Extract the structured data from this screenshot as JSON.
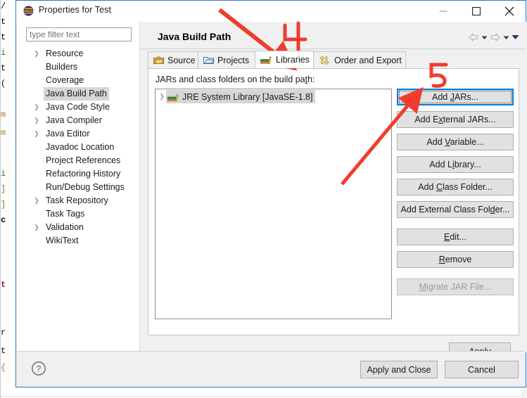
{
  "window": {
    "title": "Properties for Test",
    "app_icon": "eclipse-logo-icon",
    "controls": {
      "minimize": "minimize-icon",
      "maximize": "maximize-icon",
      "close": "close-icon"
    }
  },
  "sidebar": {
    "filter": {
      "placeholder": "type filter text",
      "value": ""
    },
    "items": [
      {
        "label": "Resource",
        "expandable": true,
        "selected": false
      },
      {
        "label": "Builders",
        "expandable": false,
        "selected": false
      },
      {
        "label": "Coverage",
        "expandable": false,
        "selected": false
      },
      {
        "label": "Java Build Path",
        "expandable": false,
        "selected": true
      },
      {
        "label": "Java Code Style",
        "expandable": true,
        "selected": false
      },
      {
        "label": "Java Compiler",
        "expandable": true,
        "selected": false
      },
      {
        "label": "Java Editor",
        "expandable": true,
        "selected": false
      },
      {
        "label": "Javadoc Location",
        "expandable": false,
        "selected": false
      },
      {
        "label": "Project References",
        "expandable": false,
        "selected": false
      },
      {
        "label": "Refactoring History",
        "expandable": false,
        "selected": false
      },
      {
        "label": "Run/Debug Settings",
        "expandable": false,
        "selected": false
      },
      {
        "label": "Task Repository",
        "expandable": true,
        "selected": false
      },
      {
        "label": "Task Tags",
        "expandable": false,
        "selected": false
      },
      {
        "label": "Validation",
        "expandable": true,
        "selected": false
      },
      {
        "label": "WikiText",
        "expandable": false,
        "selected": false
      }
    ]
  },
  "content": {
    "page_title": "Java Build Path",
    "nav": {
      "back_icon": "left-arrow-icon",
      "back_menu_icon": "chevron-down-icon",
      "forward_icon": "right-arrow-icon",
      "forward_menu_icon": "chevron-down-icon",
      "history_icon": "chevron-down-filled-icon"
    },
    "tabs": [
      {
        "label": "Source",
        "icon": "source-folder-icon",
        "active": false
      },
      {
        "label": "Projects",
        "icon": "projects-folder-icon",
        "active": false
      },
      {
        "label": "Libraries",
        "icon": "libraries-books-icon",
        "active": true
      },
      {
        "label": "Order and Export",
        "icon": "order-export-icon",
        "active": false
      }
    ],
    "panel": {
      "label_pre": "JARs and class folders on the build pa",
      "label_mnemonic": "t",
      "label_post": "h:",
      "tree_items": [
        {
          "label": "JRE System Library [JavaSE-1.8]",
          "icon": "jre-library-icon",
          "expandable": true,
          "selected": true
        }
      ]
    },
    "side_buttons": [
      {
        "pre": "Add ",
        "mnemonic": "J",
        "post": "ARs...",
        "state": "focused"
      },
      {
        "pre": "Add E",
        "mnemonic": "x",
        "post": "ternal JARs...",
        "state": "normal"
      },
      {
        "pre": "Add ",
        "mnemonic": "V",
        "post": "ariable...",
        "state": "normal"
      },
      {
        "pre": "Add L",
        "mnemonic": "i",
        "post": "brary...",
        "state": "normal"
      },
      {
        "pre": "Add ",
        "mnemonic": "C",
        "post": "lass Folder...",
        "state": "normal"
      },
      {
        "pre": "Add External Class Fol",
        "mnemonic": "d",
        "post": "er...",
        "state": "normal"
      },
      {
        "pre": "",
        "mnemonic": "E",
        "post": "dit...",
        "state": "normal",
        "gap": true
      },
      {
        "pre": "",
        "mnemonic": "R",
        "post": "emove",
        "state": "normal"
      },
      {
        "pre": "",
        "mnemonic": "M",
        "post": "igrate JAR File...",
        "state": "disabled",
        "gap": true
      }
    ],
    "apply_button": {
      "pre": "",
      "mnemonic": "A",
      "post": "pply"
    }
  },
  "footer": {
    "help_icon": "help-question-icon",
    "apply_and_close_label": "Apply and Close",
    "cancel_label": "Cancel"
  },
  "annotations": [
    {
      "name": "step-4-label",
      "text": "4",
      "color": "#f03c2e"
    },
    {
      "name": "step-5-label",
      "text": "5",
      "color": "#f03c2e"
    },
    {
      "name": "arrow-to-libraries-tab",
      "color": "#f03c2e"
    },
    {
      "name": "arrow-to-add-jars-button",
      "color": "#f03c2e"
    }
  ],
  "background": {
    "code_fragments": [
      "/",
      "t",
      "t",
      "i",
      "t",
      "(",
      "m",
      "m",
      "i",
      "]",
      "]",
      "c",
      "t",
      "r",
      "t",
      "{"
    ]
  },
  "colors": {
    "accent": "#0078d7",
    "dialog_border": "#2b78c8",
    "annotation_red": "#f03c2e",
    "button_face": "#e1e1e1",
    "selection": "#d6d6d6"
  }
}
